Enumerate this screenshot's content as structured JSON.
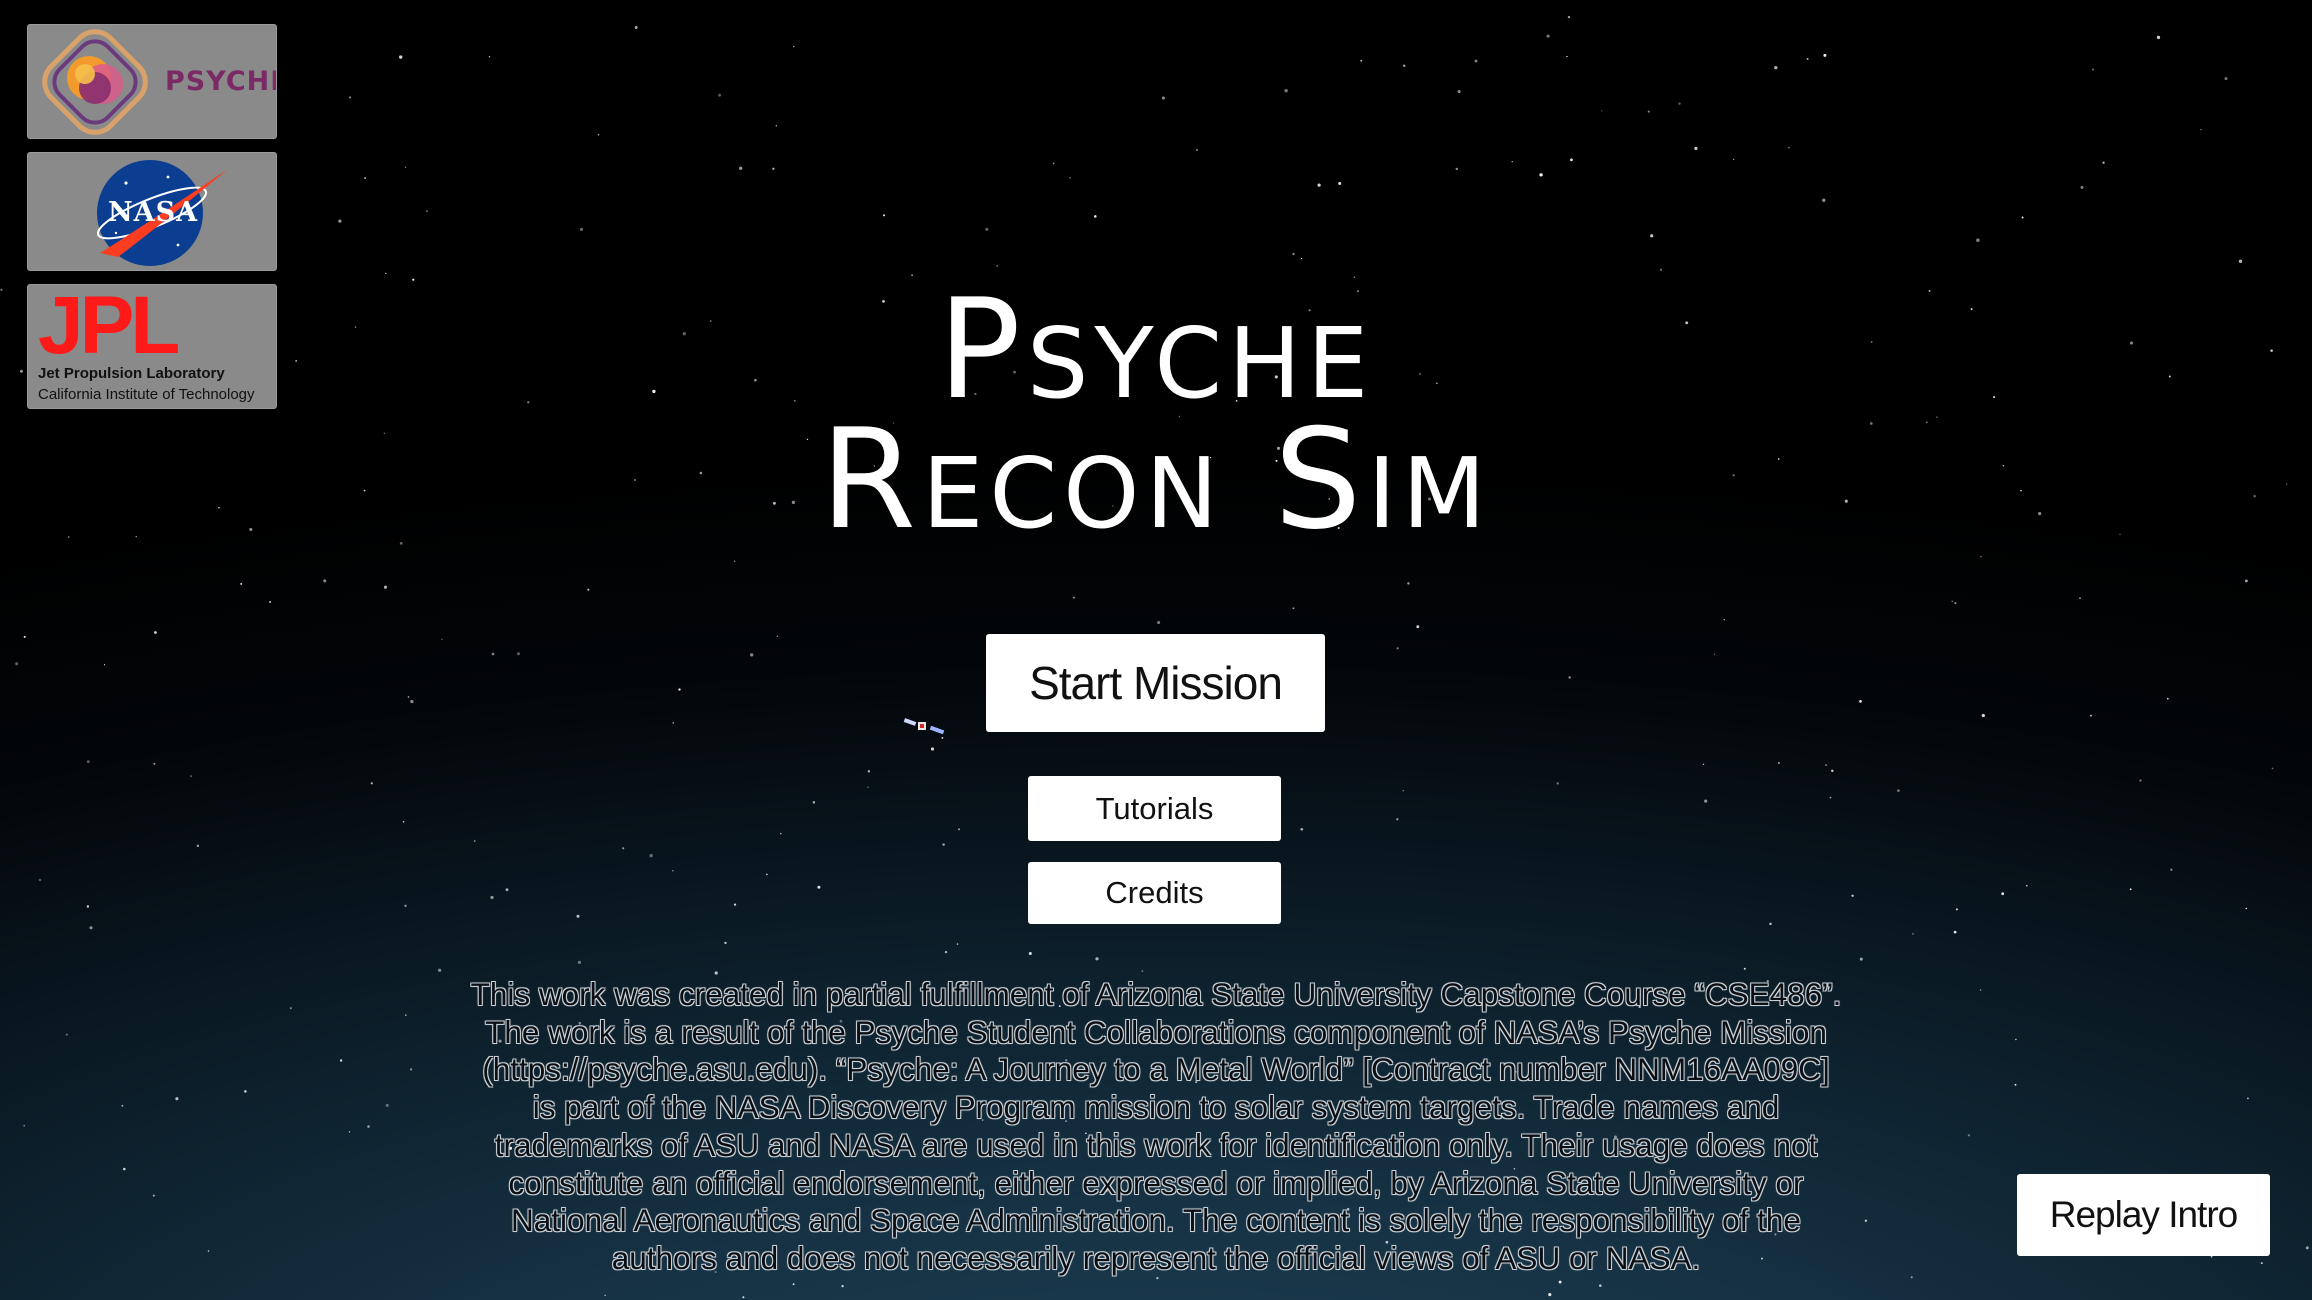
{
  "game": {
    "title_line1": "Psyche",
    "title_line2": "Recon Sim"
  },
  "logos": {
    "psyche": {
      "label": "PSYCHE",
      "icon": "psyche-mission-icon"
    },
    "nasa": {
      "label": "NASA",
      "icon": "nasa-meatball-icon"
    },
    "jpl": {
      "letters": "JPL",
      "line1": "Jet Propulsion Laboratory",
      "line2": "California Institute of Technology"
    }
  },
  "menu": {
    "start_label": "Start Mission",
    "tutorials_label": "Tutorials",
    "credits_label": "Credits",
    "replay_label": "Replay Intro"
  },
  "disclaimer": {
    "lines": [
      "This work was created in partial fulfillment of Arizona State University Capstone Course “CSE486”.",
      "The work is a result of the Psyche Student Collaborations component of NASA’s Psyche Mission",
      "(https://psyche.asu.edu). “Psyche: A Journey to a Metal World” [Contract number NNM16AA09C]",
      "is part of the NASA Discovery Program mission to solar system targets. Trade names and",
      "trademarks of ASU and NASA are used in this work for identification only. Their usage does not",
      "constitute an official endorsement, either expressed or implied, by Arizona State University or",
      "National Aeronautics and Space Administration. The content is solely the responsibility of the",
      "authors and does not necessarily represent the official views of ASU or NASA."
    ]
  },
  "colors": {
    "button_bg": "#ffffff",
    "title_text": "#ffffff",
    "psyche_brand": "#7b2a66",
    "jpl_red": "#ff1a1a",
    "nasa_blue": "#0b3d91",
    "nasa_red": "#fc3d21"
  },
  "background": {
    "icon": "starfield-background"
  }
}
